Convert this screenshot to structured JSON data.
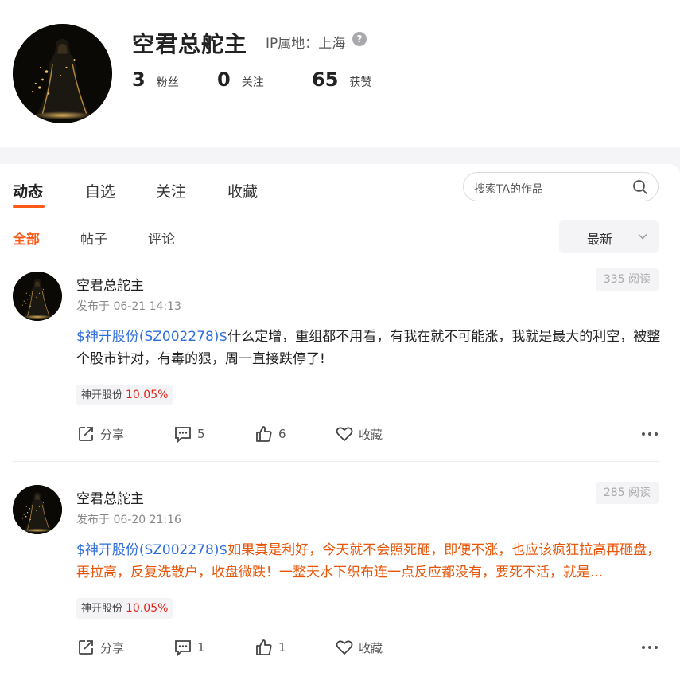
{
  "profile": {
    "name": "空君总舵主",
    "ip_location": "IP属地：上海",
    "help_icon": "?",
    "stats": [
      {
        "value": "3",
        "label": "粉丝"
      },
      {
        "value": "0",
        "label": "关注"
      },
      {
        "value": "65",
        "label": "获赞"
      }
    ]
  },
  "main_tabs": [
    {
      "label": "动态",
      "active": true
    },
    {
      "label": "自选",
      "active": false
    },
    {
      "label": "关注",
      "active": false
    },
    {
      "label": "收藏",
      "active": false
    }
  ],
  "search": {
    "placeholder": "搜索TA的作品",
    "icon": "search-icon"
  },
  "sub_tabs": [
    {
      "label": "全部",
      "active": true
    },
    {
      "label": "帖子",
      "active": false
    },
    {
      "label": "评论",
      "active": false
    }
  ],
  "sort": {
    "selected": "最新",
    "icon": "chevron-down-icon"
  },
  "colors": {
    "accent": "#ff5a16",
    "link": "#2f6fdb",
    "post_orange": "#e8560a",
    "pct_red": "#e0241a"
  },
  "posts": [
    {
      "author": "空君总舵主",
      "time": "发布于 06-21 14:13",
      "reads": "335 阅读",
      "stock_link": "$神开股份(SZ002278)$",
      "text": "什么定增，重组都不用看，有我在就不可能涨，我就是最大的利空，被整个股市针对，有毒的狠，周一直接跌停了!",
      "tag_name": "神开股份",
      "tag_pct": "10.05%",
      "share_label": "分享",
      "comments": "5",
      "likes": "6",
      "fav_label": "收藏"
    },
    {
      "author": "空君总舵主",
      "time": "发布于 06-20 21:16",
      "reads": "285 阅读",
      "stock_link": "$神开股份(SZ002278)$",
      "text": "如果真是利好，今天就不会照死砸，即便不涨，也应该疯狂拉高再砸盘，再拉高，反复洗散户，收盘微跌！一整天水下织布连一点反应都没有，要死不活，就是...",
      "tag_name": "神开股份",
      "tag_pct": "10.05%",
      "share_label": "分享",
      "comments": "1",
      "likes": "1",
      "fav_label": "收藏"
    }
  ]
}
